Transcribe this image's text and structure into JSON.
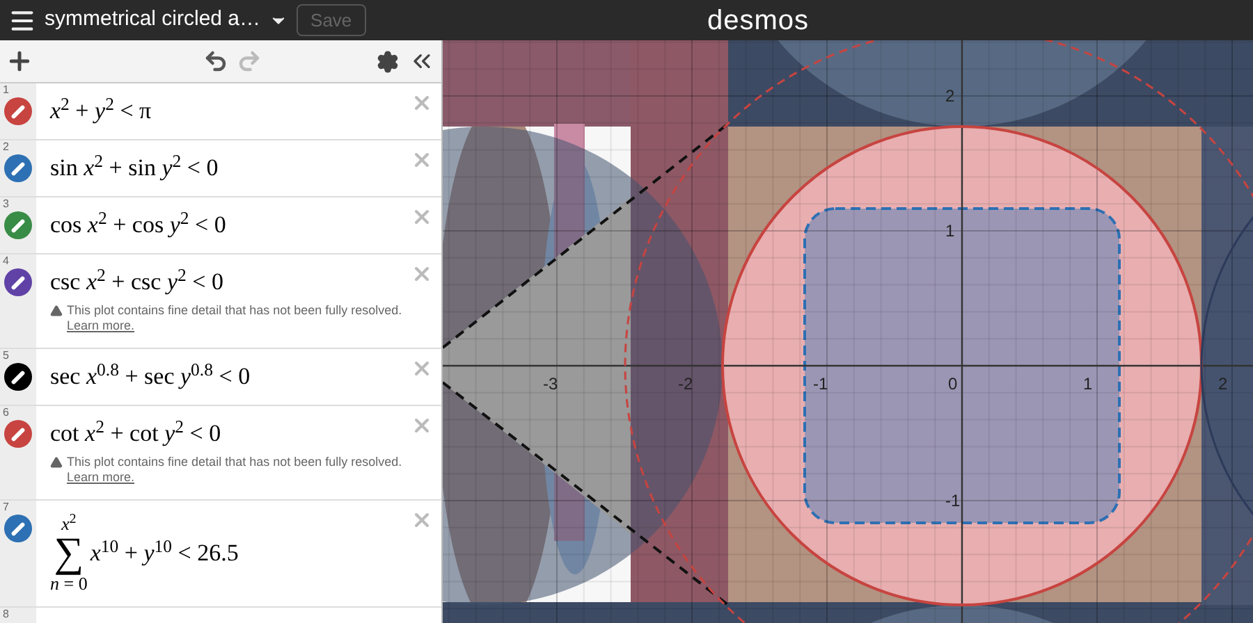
{
  "header": {
    "title": "symmetrical circled a…",
    "save_button": {
      "label": "Save",
      "disabled": true
    },
    "logo": "desmos"
  },
  "toolbar": {
    "redo_disabled": true
  },
  "expressions": [
    {
      "number": "1",
      "kind": "expr",
      "color": "#c74440",
      "latex": "*x*$^{2}$ + *y*$^{2}$ < π"
    },
    {
      "number": "2",
      "kind": "expr",
      "color": "#2d70b3",
      "latex": "sin *x*$^{2}$ + sin *y*$^{2}$ < 0"
    },
    {
      "number": "3",
      "kind": "expr",
      "color": "#388c46",
      "latex": "cos *x*$^{2}$ + cos *y*$^{2}$ < 0"
    },
    {
      "number": "4",
      "kind": "expr",
      "color": "#6042a6",
      "latex": "csc *x*$^{2}$ + csc *y*$^{2}$ < 0",
      "warning": {
        "text": "This plot contains fine detail that has not been fully resolved.",
        "link": "Learn more."
      }
    },
    {
      "number": "5",
      "kind": "expr",
      "color": "#000000",
      "latex": "sec *x*$^{0.8}$ + sec *y*$^{0.8}$ < 0"
    },
    {
      "number": "6",
      "kind": "expr",
      "color": "#c74440",
      "latex": "cot *x*$^{2}$ + cot *y*$^{2}$ < 0",
      "warning": {
        "text": "This plot contains fine detail that has not been fully resolved.",
        "link": "Learn more."
      }
    },
    {
      "number": "7",
      "kind": "sum",
      "color": "#2d70b3",
      "symbol": "∑",
      "upper": "*x*$^{2}$",
      "lower": "*n* = 0",
      "latex": "*x*$^{10}$ + *y*$^{10}$ < 26.5"
    },
    {
      "number": "8",
      "kind": "empty"
    }
  ],
  "graph": {
    "x_ticks": [
      "-3",
      "-2",
      "-1",
      "0",
      "1",
      "2"
    ],
    "y_ticks": [
      "2",
      "1",
      "-1"
    ]
  }
}
